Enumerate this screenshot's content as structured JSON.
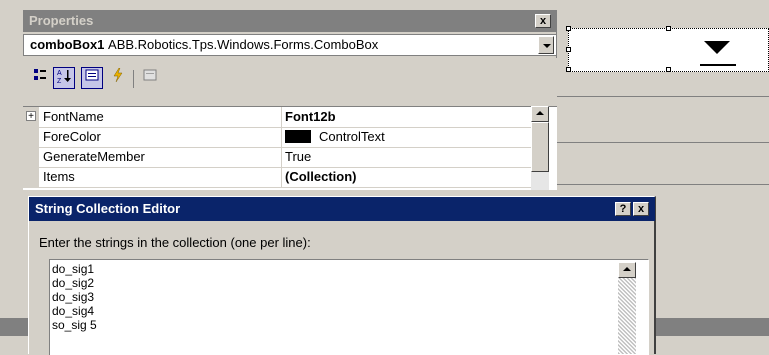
{
  "properties_window": {
    "title": "Properties",
    "close_glyph": "x",
    "object_name": "comboBox1",
    "object_type": "ABB.Robotics.Tps.Windows.Forms.ComboBox",
    "toolbar": {
      "icons": [
        "categorized-icon",
        "alphabetical-icon",
        "properties-icon",
        "events-icon",
        "property-pages-icon"
      ]
    },
    "rows": [
      {
        "name": "FontName",
        "value": "Font12b",
        "bold": true,
        "expandable": true
      },
      {
        "name": "ForeColor",
        "value": "ControlText",
        "swatch_color": "#000000"
      },
      {
        "name": "GenerateMember",
        "value": "True"
      },
      {
        "name": "Items",
        "value": "(Collection)",
        "bold": true
      }
    ]
  },
  "dialog": {
    "title": "String Collection Editor",
    "help_glyph": "?",
    "close_glyph": "x",
    "instruction": "Enter the strings in the collection (one per line):",
    "lines": [
      "do_sig1",
      "do_sig2",
      "do_sig3",
      "do_sig4",
      "so_sig 5"
    ]
  },
  "colors": {
    "dialog_title_bg": "#0a246a",
    "inactive_title_bg": "#808080",
    "face": "#d4d0c8"
  }
}
